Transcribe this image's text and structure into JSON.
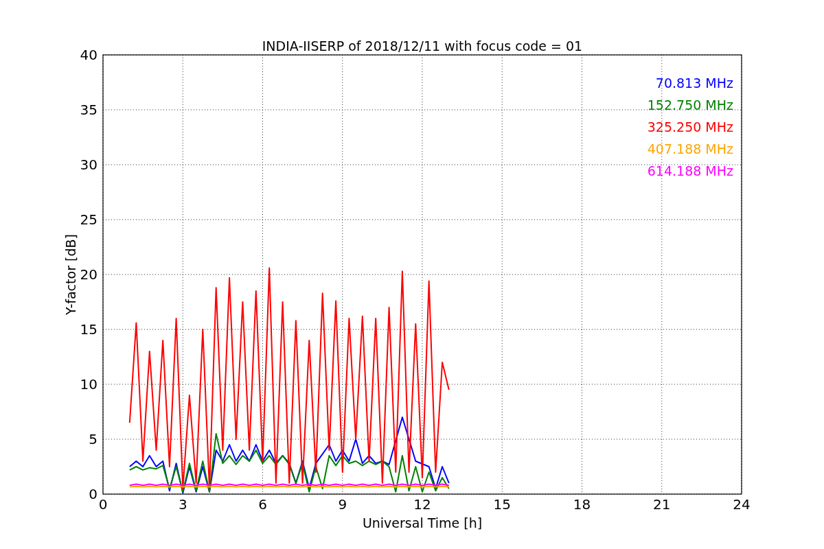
{
  "chart_data": {
    "type": "line",
    "title": "INDIA-IISERP of 2018/12/11 with focus code = 01",
    "xlabel": "Universal Time [h]",
    "ylabel": "Y-factor [dB]",
    "x": [
      1,
      1.25,
      1.5,
      1.75,
      2,
      2.25,
      2.5,
      2.75,
      3,
      3.25,
      3.5,
      3.75,
      4,
      4.25,
      4.5,
      4.75,
      5,
      5.25,
      5.5,
      5.75,
      6,
      6.25,
      6.5,
      6.75,
      7,
      7.25,
      7.5,
      7.75,
      8,
      8.25,
      8.5,
      8.75,
      9,
      9.25,
      9.5,
      9.75,
      10,
      10.25,
      10.5,
      10.75,
      11,
      11.25,
      11.5,
      11.75,
      12,
      12.25,
      12.5,
      12.75,
      13
    ],
    "grid": true,
    "xlim": [
      0,
      24
    ],
    "ylim": [
      0,
      40
    ],
    "xticks": [
      0,
      3,
      6,
      9,
      12,
      15,
      18,
      21,
      24
    ],
    "yticks": [
      0,
      5,
      10,
      15,
      20,
      25,
      30,
      35,
      40
    ],
    "series": [
      {
        "name": "70.813 MHz",
        "color": "#0000ff",
        "values": [
          2.5,
          3,
          2.5,
          3.5,
          2.5,
          3,
          0.3,
          2.8,
          0.1,
          2.5,
          0.2,
          2.5,
          0.2,
          4,
          3,
          4.5,
          3,
          4,
          3,
          4.5,
          3,
          4,
          2.8,
          3.5,
          2.8,
          1,
          3,
          0.5,
          2.8,
          null,
          4.5,
          3,
          4,
          3,
          5,
          2.8,
          3.5,
          2.8,
          3,
          2.7,
          null,
          7,
          null,
          3,
          null,
          2.5,
          0.5,
          2.5,
          1
        ]
      },
      {
        "name": "152.750 MHz",
        "color": "#008000",
        "values": [
          2.2,
          2.5,
          2.2,
          2.4,
          2.3,
          2.6,
          0.5,
          2.5,
          0.2,
          2.8,
          0.3,
          3.0,
          0.2,
          5.5,
          2.8,
          3.5,
          2.7,
          3.5,
          3,
          4,
          2.8,
          3.5,
          2.7,
          3.5,
          2.7,
          1,
          2.8,
          0.2,
          2.5,
          0.5,
          3.5,
          2.6,
          3.5,
          2.8,
          3,
          2.6,
          3,
          2.7,
          3,
          2.5,
          0.2,
          3.5,
          0.3,
          2.5,
          0.2,
          2,
          0.3,
          1.5,
          0.5
        ]
      },
      {
        "name": "325.250 MHz",
        "color": "#ff0000",
        "values": [
          6.5,
          15.6,
          3,
          13,
          4,
          14,
          2.5,
          16,
          0.5,
          9,
          1,
          15,
          0.5,
          18.8,
          4,
          19.7,
          5,
          17.5,
          4,
          18.5,
          3,
          20.6,
          1,
          17.5,
          1,
          15.8,
          1,
          14,
          2,
          18.3,
          4,
          17.6,
          2,
          16,
          5,
          16.2,
          3,
          16,
          1,
          17,
          2,
          20.3,
          2,
          15.5,
          1.5,
          19.4,
          2,
          12,
          9.5
        ]
      },
      {
        "name": "407.188 MHz",
        "color": "#ffa500",
        "values": [
          0.65,
          0.7,
          0.65,
          0.7,
          0.65,
          0.7,
          0.65,
          0.7,
          0.65,
          0.7,
          0.65,
          0.7,
          0.65,
          0.7,
          0.65,
          0.7,
          0.65,
          0.7,
          0.65,
          0.7,
          0.65,
          0.7,
          0.65,
          0.7,
          0.65,
          0.7,
          0.65,
          0.7,
          0.65,
          0.7,
          0.65,
          0.7,
          0.65,
          0.7,
          0.65,
          0.7,
          0.65,
          0.7,
          0.65,
          0.7,
          0.65,
          0.7,
          0.65,
          0.7,
          0.65,
          0.7,
          0.65,
          0.7,
          0.65
        ]
      },
      {
        "name": "614.188 MHz",
        "color": "#ff00ff",
        "values": [
          0.8,
          0.9,
          0.8,
          0.9,
          0.8,
          0.9,
          0.8,
          0.9,
          0.8,
          0.9,
          0.8,
          0.9,
          0.8,
          0.9,
          0.8,
          0.9,
          0.8,
          0.9,
          0.8,
          0.9,
          0.8,
          0.9,
          0.8,
          0.9,
          0.8,
          0.9,
          0.8,
          0.9,
          0.8,
          0.9,
          0.8,
          0.9,
          0.8,
          0.9,
          0.8,
          0.9,
          0.8,
          0.9,
          0.8,
          0.9,
          0.8,
          0.9,
          0.8,
          0.9,
          0.8,
          0.9,
          0.8,
          0.9,
          0.8
        ]
      }
    ]
  }
}
